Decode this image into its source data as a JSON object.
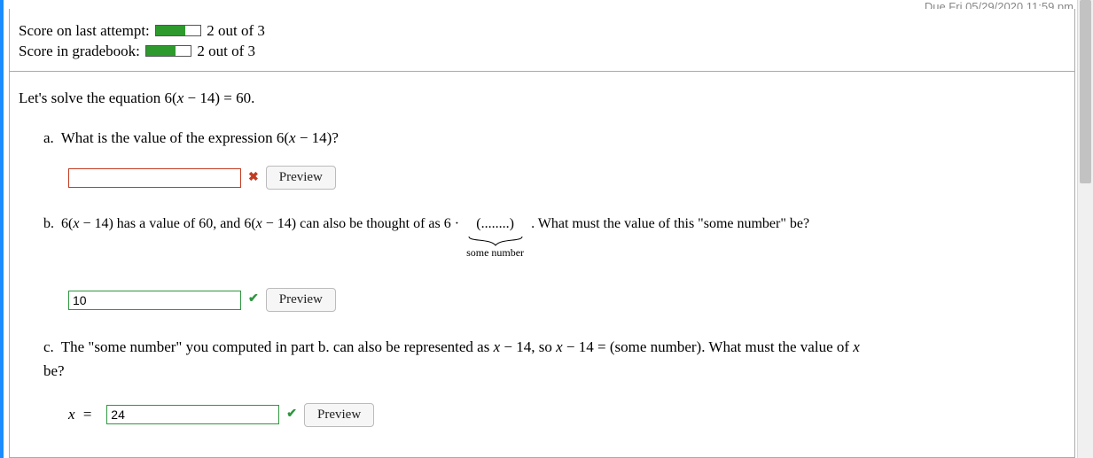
{
  "due": "Due Fri 05/29/2020 11:59 pm",
  "scores": {
    "lastAttemptLabel": "Score on last attempt:",
    "lastAttemptText": "2 out of 3",
    "gradebookLabel": "Score in gradebook:",
    "gradebookText": "2 out of 3",
    "fillPercent": "66.6%"
  },
  "prompt": {
    "lead": "Let's solve the equation ",
    "eq1_pre": "6(",
    "eq1_var": "x",
    "eq1_mid": " − 14) = 60",
    "tail": "."
  },
  "partA": {
    "letter": "a.",
    "text1": "What is the value of the expression ",
    "eq_pre": "6(",
    "eq_var": "x",
    "eq_post": " − 14)?",
    "inputValue": "",
    "previewLabel": "Preview"
  },
  "partB": {
    "letter": "b.",
    "t1_pre": "6(",
    "t1_var": "x",
    "t1_post": " − 14)",
    "t2": " has a value of 60, and ",
    "t3_pre": "6(",
    "t3_var": "x",
    "t3_post": " − 14)",
    "t4": " can also be thought of as 6 · ",
    "paren_open": "(",
    "dots": "........",
    "paren_close": ")",
    "braceLabel": "some number",
    "t5": " . What must the value of this \"some number\" be?",
    "inputValue": "10",
    "previewLabel": "Preview"
  },
  "partC": {
    "letter": "c.",
    "t1": "The \"some number\" you computed in part b. can also be represented as ",
    "e1_var": "x",
    "e1_post": " − 14",
    "t2": ", so ",
    "e2_var": "x",
    "e2_post": " − 14 = (some number)",
    "t3": ". What must the value of ",
    "e3_var": "x",
    "t4": " be?",
    "xEqLabel_var": "x",
    "xEqLabel_eq": "=",
    "inputValue": "24",
    "previewLabel": "Preview"
  }
}
